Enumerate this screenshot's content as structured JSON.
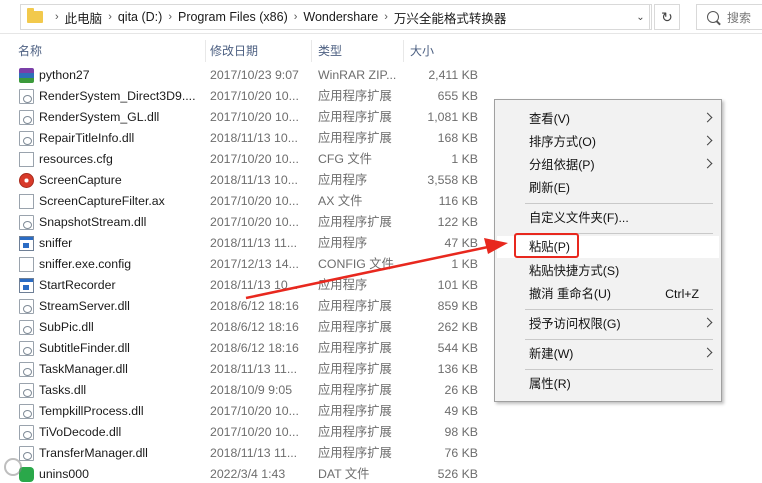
{
  "address_bar": {
    "crumbs": [
      "此电脑",
      "qita (D:)",
      "Program Files (x86)",
      "Wondershare",
      "万兴全能格式转换器"
    ],
    "search_placeholder": "搜索"
  },
  "columns": {
    "name": "名称",
    "date": "修改日期",
    "type": "类型",
    "size": "大小"
  },
  "files": [
    {
      "name": "python27",
      "date": "2017/10/23 9:07",
      "type": "WinRAR ZIP...",
      "size": "2,411 KB",
      "icon": "winrar-icon"
    },
    {
      "name": "RenderSystem_Direct3D9....",
      "date": "2017/10/20 10...",
      "type": "应用程序扩展",
      "size": "655 KB",
      "icon": "dll-icon"
    },
    {
      "name": "RenderSystem_GL.dll",
      "date": "2017/10/20 10...",
      "type": "应用程序扩展",
      "size": "1,081 KB",
      "icon": "dll-icon"
    },
    {
      "name": "RepairTitleInfo.dll",
      "date": "2018/11/13 10...",
      "type": "应用程序扩展",
      "size": "168 KB",
      "icon": "dll-icon"
    },
    {
      "name": "resources.cfg",
      "date": "2017/10/20 10...",
      "type": "CFG 文件",
      "size": "1 KB",
      "icon": "file-icon"
    },
    {
      "name": "ScreenCapture",
      "date": "2018/11/13 10...",
      "type": "应用程序",
      "size": "3,558 KB",
      "icon": "record-icon"
    },
    {
      "name": "ScreenCaptureFilter.ax",
      "date": "2017/10/20 10...",
      "type": "AX 文件",
      "size": "116 KB",
      "icon": "file-icon"
    },
    {
      "name": "SnapshotStream.dll",
      "date": "2017/10/20 10...",
      "type": "应用程序扩展",
      "size": "122 KB",
      "icon": "dll-icon"
    },
    {
      "name": "sniffer",
      "date": "2018/11/13 11...",
      "type": "应用程序",
      "size": "47 KB",
      "icon": "exe-icon"
    },
    {
      "name": "sniffer.exe.config",
      "date": "2017/12/13 14...",
      "type": "CONFIG 文件",
      "size": "1 KB",
      "icon": "file-icon"
    },
    {
      "name": "StartRecorder",
      "date": "2018/11/13 10...",
      "type": "应用程序",
      "size": "101 KB",
      "icon": "exe-icon"
    },
    {
      "name": "StreamServer.dll",
      "date": "2018/6/12 18:16",
      "type": "应用程序扩展",
      "size": "859 KB",
      "icon": "dll-icon"
    },
    {
      "name": "SubPic.dll",
      "date": "2018/6/12 18:16",
      "type": "应用程序扩展",
      "size": "262 KB",
      "icon": "dll-icon"
    },
    {
      "name": "SubtitleFinder.dll",
      "date": "2018/6/12 18:16",
      "type": "应用程序扩展",
      "size": "544 KB",
      "icon": "dll-icon"
    },
    {
      "name": "TaskManager.dll",
      "date": "2018/11/13 11...",
      "type": "应用程序扩展",
      "size": "136 KB",
      "icon": "dll-icon"
    },
    {
      "name": "Tasks.dll",
      "date": "2018/10/9 9:05",
      "type": "应用程序扩展",
      "size": "26 KB",
      "icon": "dll-icon"
    },
    {
      "name": "TempkillProcess.dll",
      "date": "2017/10/20 10...",
      "type": "应用程序扩展",
      "size": "49 KB",
      "icon": "dll-icon"
    },
    {
      "name": "TiVoDecode.dll",
      "date": "2017/10/20 10...",
      "type": "应用程序扩展",
      "size": "98 KB",
      "icon": "dll-icon"
    },
    {
      "name": "TransferManager.dll",
      "date": "2018/11/13 11...",
      "type": "应用程序扩展",
      "size": "76 KB",
      "icon": "dll-icon"
    },
    {
      "name": "unins000",
      "date": "2022/3/4 1:43",
      "type": "DAT 文件",
      "size": "526 KB",
      "icon": "green-icon"
    }
  ],
  "context_menu": {
    "view": "查看(V)",
    "sort": "排序方式(O)",
    "group": "分组依据(P)",
    "refresh": "刷新(E)",
    "customize": "自定义文件夹(F)...",
    "paste": "粘贴(P)",
    "paste_shortcut": "粘贴快捷方式(S)",
    "undo": "撤消 重命名(U)",
    "undo_shortcut": "Ctrl+Z",
    "grant_access": "授予访问权限(G)",
    "new": "新建(W)",
    "properties": "属性(R)"
  },
  "colors": {
    "highlight": "#e8281e",
    "header_text": "#4d6082"
  }
}
